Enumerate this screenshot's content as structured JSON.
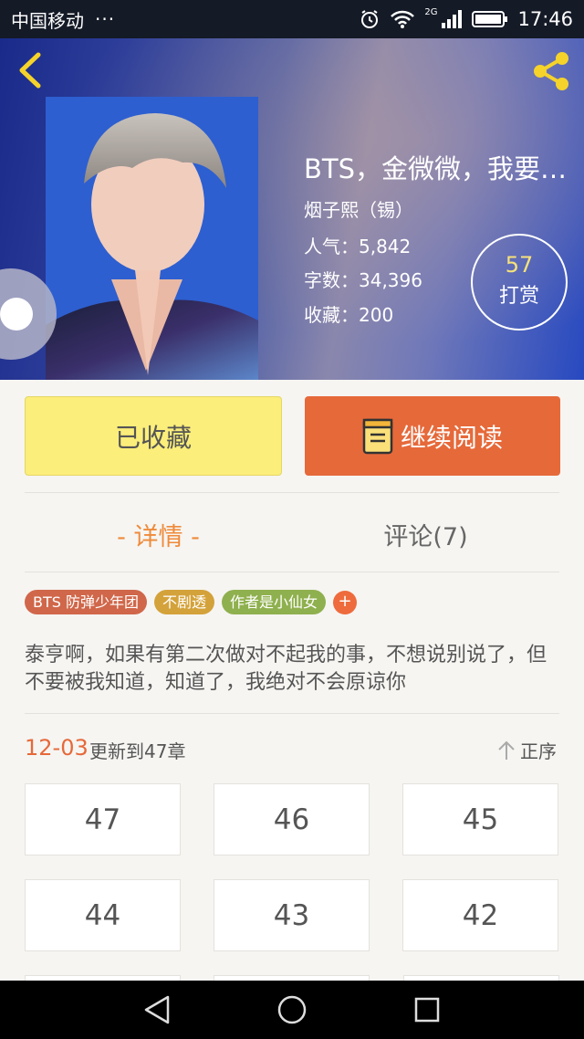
{
  "status_bar": {
    "carrier": "中国移动",
    "dots": "···",
    "network": "2G",
    "time": "17:46"
  },
  "book": {
    "title": "BTS，金微微，我要…",
    "author": "烟子熙（锡）",
    "popularity": "人气：5,842",
    "word_count": "字数：34,396",
    "favorites": "收藏：200",
    "reward_count": "57",
    "reward_label": "打赏"
  },
  "actions": {
    "collected_label": "已收藏",
    "continue_label": "继续阅读"
  },
  "tabs": {
    "details": "- 详情 -",
    "comments": "评论(7)"
  },
  "tags": [
    {
      "label": "BTS 防弹少年团",
      "color": "#d0674a"
    },
    {
      "label": "不剧透",
      "color": "#d4a23a"
    },
    {
      "label": "作者是小仙女",
      "color": "#8fb04e"
    }
  ],
  "tag_add": "+",
  "description": "泰亨啊，如果有第二次做对不起我的事，不想说别说了，但不要被我知道，知道了，我绝对不会原谅你",
  "updates": {
    "date": "12-03",
    "text": "更新到47章",
    "sort_label": "正序"
  },
  "chapters": [
    "47",
    "46",
    "45",
    "44",
    "43",
    "42"
  ],
  "colors": {
    "accent_orange": "#e6693a",
    "collected_yellow": "#fbee7a",
    "icon_yellow": "#f5d32a"
  }
}
